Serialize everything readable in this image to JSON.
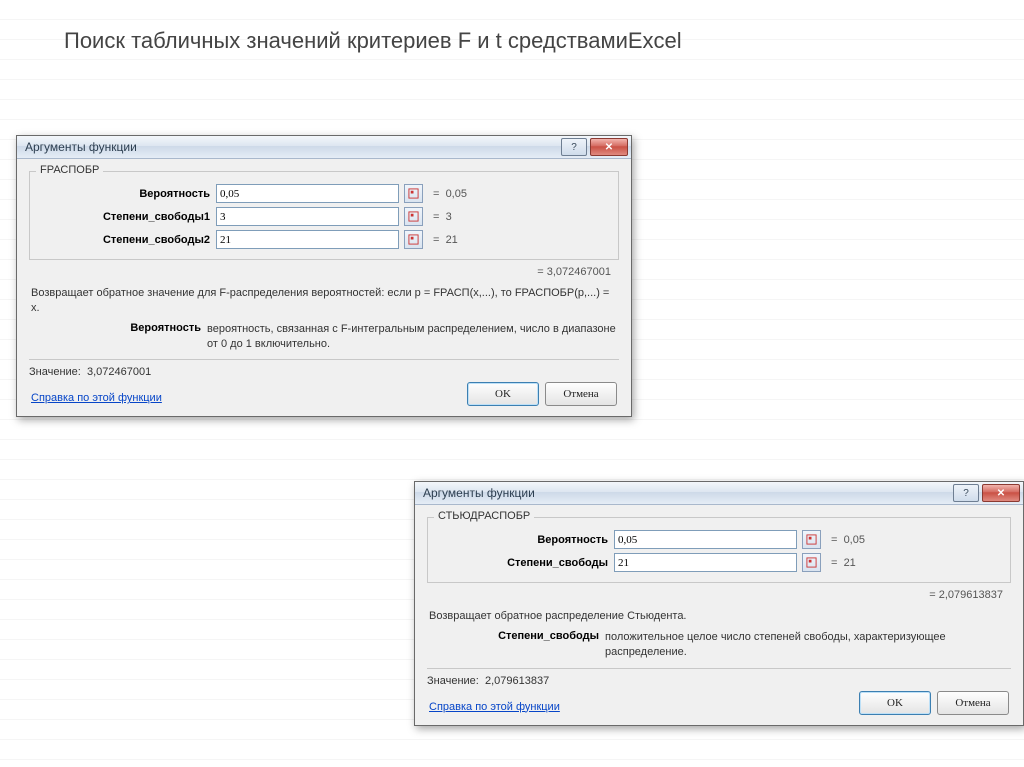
{
  "page": {
    "title": "Поиск табличных значений критериев F и t средствамиExcel"
  },
  "dialog1": {
    "title": "Аргументы функции",
    "function_name": "FРАСПОБР",
    "args": {
      "probability": {
        "label": "Вероятность",
        "value": "0,05",
        "echo": "0,05"
      },
      "df1": {
        "label": "Степени_свободы1",
        "value": "3",
        "echo": "3"
      },
      "df2": {
        "label": "Степени_свободы2",
        "value": "21",
        "echo": "21"
      }
    },
    "result_eq": "=  3,072467001",
    "description": "Возвращает обратное значение для F-распределения вероятностей: если p = FРАСП(x,...), то FРАСПОБР(p,...) = x.",
    "argdesc": {
      "name": "Вероятность",
      "text": "вероятность, связанная с F-интегральным распределением, число в диапазоне от 0 до 1 включительно."
    },
    "value_label": "Значение:",
    "value": "3,072467001",
    "help": "Справка по этой функции",
    "ok": "OK",
    "cancel": "Отмена"
  },
  "dialog2": {
    "title": "Аргументы функции",
    "function_name": "СТЬЮДРАСПОБР",
    "args": {
      "probability": {
        "label": "Вероятность",
        "value": "0,05",
        "echo": "0,05"
      },
      "df": {
        "label": "Степени_свободы",
        "value": "21",
        "echo": "21"
      }
    },
    "result_eq": "=  2,079613837",
    "description": "Возвращает обратное распределение Стьюдента.",
    "argdesc": {
      "name": "Степени_свободы",
      "text": "положительное целое число степеней свободы, характеризующее распределение."
    },
    "value_label": "Значение:",
    "value": "2,079613837",
    "help": "Справка по этой функции",
    "ok": "OK",
    "cancel": "Отмена"
  },
  "equals": "="
}
